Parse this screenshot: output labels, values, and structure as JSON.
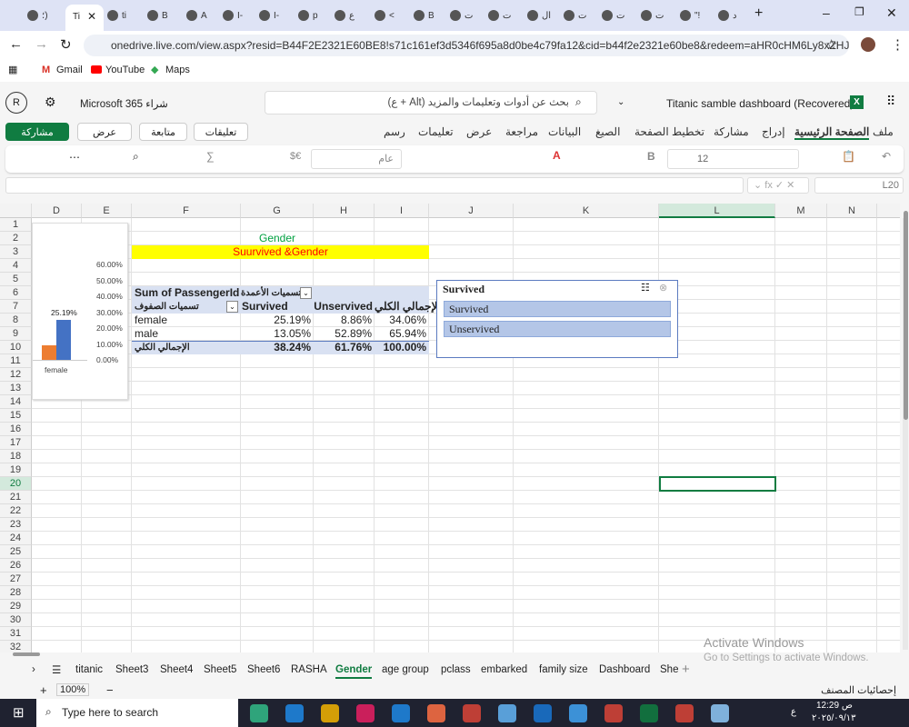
{
  "browser": {
    "active_tab": "Ti",
    "tabs": [
      "؛)",
      "Ti",
      "ti",
      "B",
      "A",
      "I-",
      "I-",
      "p",
      "ع",
      "<",
      "B",
      "ت",
      "ت",
      "ال",
      "ت",
      "ت",
      "ت",
      "\"!",
      "د"
    ],
    "url": "onedrive.live.com/view.aspx?resid=B44F2E2321E60BE8!s71c161ef3d5346f695a8d0be4c79fa12&cid=b44f2e2321e60be8&redeem=aHR0cHM6Ly8xZHJ2Lm1zL2Y...",
    "bookmarks": [
      "Gmail",
      "YouTube",
      "Maps"
    ]
  },
  "app": {
    "avatar": "R",
    "buy": "Microsoft 365 شراء",
    "search_placeholder": "بحث عن أدوات وتعليمات والمزيد (Alt + ع)",
    "doc_title": "Titanic samble dashboard (Recovered)",
    "share": "مشاركة",
    "view": "عرض",
    "follow": "متابعة",
    "comments": "تعليقات",
    "menus": [
      "ملف",
      "الصفحة الرئيسية",
      "إدراج",
      "مشاركة",
      "تخطيط الصفحة",
      "الصيغ",
      "البيانات",
      "مراجعة",
      "عرض",
      "تعليمات",
      "رسم"
    ],
    "active_menu": "الصفحة الرئيسية",
    "font_size": "12",
    "number_format": "عام",
    "name_box": "L20"
  },
  "columns": [
    "D",
    "E",
    "F",
    "G",
    "H",
    "I",
    "J",
    "K",
    "L",
    "M",
    "N"
  ],
  "active_cell": "L20",
  "sheet": {
    "g2": "Gender",
    "f3": "Suurvived &Gender"
  },
  "pivot": {
    "title": "Sum of PassengerId",
    "col_labels": "تسميات الأعمدة",
    "row_labels": "تسميات الصفوف",
    "headers": [
      "Survived",
      "Unservived",
      "الإجمالي الكلي"
    ],
    "rows": [
      {
        "label": "female",
        "values": [
          "25.19%",
          "8.86%",
          "34.06%"
        ]
      },
      {
        "label": "male",
        "values": [
          "13.05%",
          "52.89%",
          "65.94%"
        ]
      }
    ],
    "total": {
      "label": "الإجمالي الكلي",
      "values": [
        "38.24%",
        "61.76%",
        "100.00%"
      ]
    }
  },
  "chart": {
    "ticks": [
      "60.00%",
      "50.00%",
      "40.00%",
      "30.00%",
      "20.00%",
      "10.00%",
      "0.00%"
    ],
    "category": "female",
    "data_label": "25.19%",
    "survived": 25.19,
    "unservived": 8.86,
    "colors": {
      "survived": "#4472c4",
      "unservived": "#ed7d31"
    }
  },
  "slicer": {
    "title": "Survived",
    "items": [
      "Survived",
      "Unservived"
    ]
  },
  "sheets": [
    "titanic",
    "Sheet3",
    "Sheet4",
    "Sheet5",
    "Sheet6",
    "RASHA",
    "Gender",
    "age group",
    "pclass",
    "embarked",
    "family size",
    "Dashboard",
    "She"
  ],
  "active_sheet": "Gender",
  "status": {
    "zoom": "100%",
    "workbook_stats": "إحصائيات المصنف"
  },
  "watermark": {
    "line1": "Activate Windows",
    "line2": "Go to Settings to activate Windows."
  },
  "taskbar": {
    "search": "Type here to search",
    "time": "12:29 ص",
    "date": "٢٠٢٥/٠٩/١٣",
    "lang": "ع"
  }
}
